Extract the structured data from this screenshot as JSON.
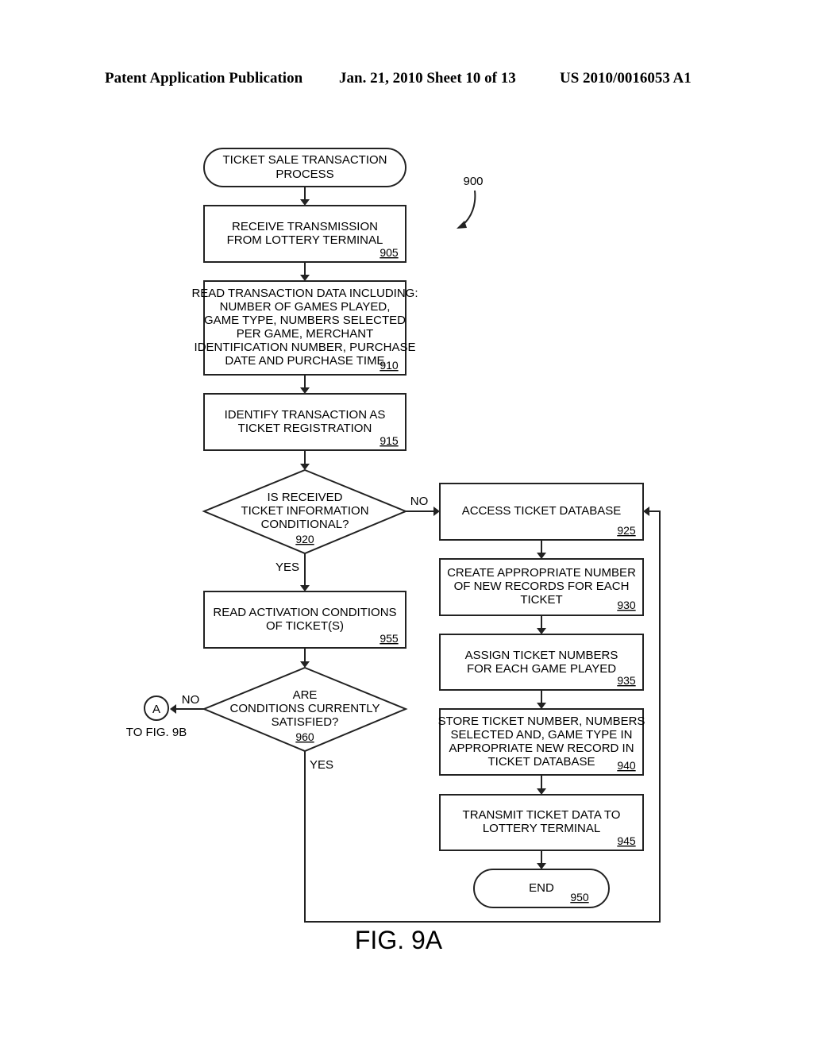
{
  "header": {
    "left": "Patent Application Publication",
    "middle": "Jan. 21, 2010  Sheet 10 of 13",
    "right": "US 2010/0016053 A1"
  },
  "diagram": {
    "ref_number": "900",
    "figure_label": "FIG. 9A",
    "nodes": {
      "start": {
        "type": "terminal",
        "lines": [
          "TICKET SALE TRANSACTION",
          "PROCESS"
        ]
      },
      "n905": {
        "type": "process",
        "ref": "905",
        "lines": [
          "RECEIVE TRANSMISSION",
          "FROM LOTTERY TERMINAL"
        ]
      },
      "n910": {
        "type": "process",
        "ref": "910",
        "lines": [
          "READ TRANSACTION DATA INCLUDING:",
          "NUMBER OF GAMES PLAYED,",
          "GAME TYPE, NUMBERS SELECTED",
          "PER GAME, MERCHANT",
          "IDENTIFICATION NUMBER, PURCHASE",
          "DATE AND PURCHASE TIME"
        ]
      },
      "n915": {
        "type": "process",
        "ref": "915",
        "lines": [
          "IDENTIFY TRANSACTION AS",
          "TICKET REGISTRATION"
        ]
      },
      "n920": {
        "type": "decision",
        "ref": "920",
        "lines": [
          "IS RECEIVED",
          "TICKET INFORMATION",
          "CONDITIONAL?"
        ]
      },
      "n925": {
        "type": "process",
        "ref": "925",
        "lines": [
          "ACCESS TICKET DATABASE"
        ]
      },
      "n930": {
        "type": "process",
        "ref": "930",
        "lines": [
          "CREATE APPROPRIATE NUMBER",
          "OF NEW RECORDS FOR EACH",
          "TICKET"
        ]
      },
      "n935": {
        "type": "process",
        "ref": "935",
        "lines": [
          "ASSIGN TICKET NUMBERS",
          "FOR EACH GAME PLAYED"
        ]
      },
      "n940": {
        "type": "process",
        "ref": "940",
        "lines": [
          "STORE TICKET NUMBER, NUMBERS",
          "SELECTED AND, GAME TYPE IN",
          "APPROPRIATE NEW RECORD IN",
          "TICKET DATABASE"
        ]
      },
      "n945": {
        "type": "process",
        "ref": "945",
        "lines": [
          "TRANSMIT TICKET DATA TO",
          "LOTTERY TERMINAL"
        ]
      },
      "end": {
        "type": "terminal",
        "ref": "950",
        "lines": [
          "END"
        ]
      },
      "n955": {
        "type": "process",
        "ref": "955",
        "lines": [
          "READ ACTIVATION CONDITIONS",
          "OF TICKET(S)"
        ]
      },
      "n960": {
        "type": "decision",
        "ref": "960",
        "lines": [
          "ARE",
          "CONDITIONS CURRENTLY",
          "SATISFIED?"
        ]
      },
      "connA": {
        "type": "connector",
        "label": "A",
        "caption": "TO FIG. 9B"
      }
    },
    "edge_labels": {
      "n920_no": "NO",
      "n920_yes": "YES",
      "n960_no": "NO",
      "n960_yes": "YES"
    }
  }
}
